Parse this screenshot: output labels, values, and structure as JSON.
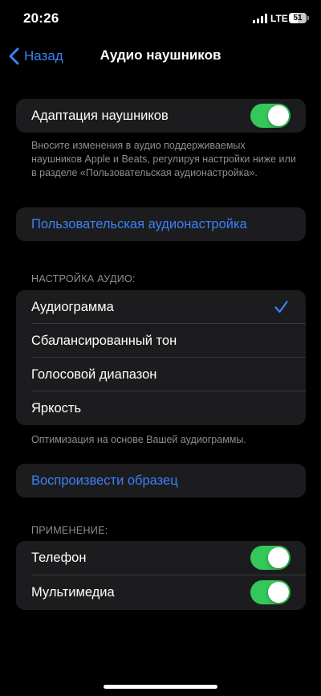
{
  "status_bar": {
    "time": "20:26",
    "network": "LTE",
    "battery_percent": 51,
    "battery_label": "51"
  },
  "nav": {
    "back_label": "Назад",
    "title": "Аудио наушников"
  },
  "adaptation": {
    "label": "Адаптация наушников",
    "enabled": true,
    "footer": "Вносите изменения в аудио поддерживаемых наушников Apple и Beats, регулируя настройки ниже или в разделе «Пользовательская аудионастройка»."
  },
  "custom_setup": {
    "label": "Пользовательская аудионастройка"
  },
  "audio_tuning": {
    "header": "НАСТРОЙКА АУДИО:",
    "options": [
      {
        "label": "Аудиограмма",
        "selected": true
      },
      {
        "label": "Сбалансированный тон",
        "selected": false
      },
      {
        "label": "Голосовой диапазон",
        "selected": false
      },
      {
        "label": "Яркость",
        "selected": false
      }
    ],
    "footer": "Оптимизация на основе Вашей аудиограммы."
  },
  "sample": {
    "label": "Воспроизвести образец"
  },
  "apply": {
    "header": "ПРИМЕНЕНИЕ:",
    "items": [
      {
        "label": "Телефон",
        "enabled": true
      },
      {
        "label": "Мультимедиа",
        "enabled": true
      }
    ]
  },
  "colors": {
    "accent_blue": "#3b82f6",
    "toggle_on": "#34c759",
    "cell_bg": "#1c1c1e",
    "secondary_text": "#8e8e93"
  }
}
